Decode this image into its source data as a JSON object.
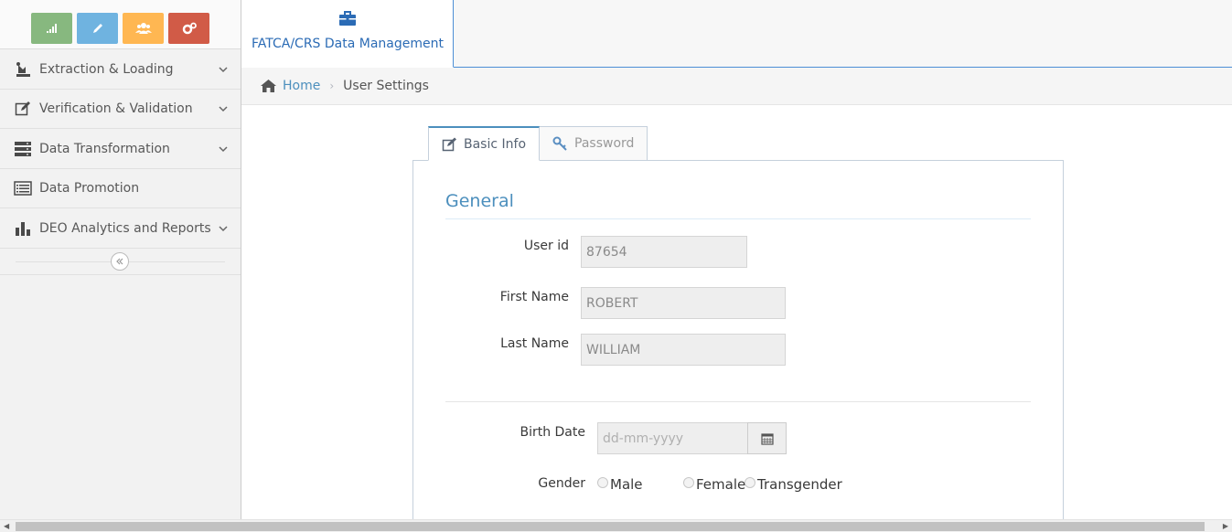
{
  "colors": {
    "shortcut_green": "#87b87f",
    "shortcut_blue": "#6fb3e0",
    "shortcut_orange": "#ffb752",
    "shortcut_red": "#d15b47",
    "accent": "#4c8fbd"
  },
  "shortcuts": [
    {
      "icon": "signal-icon"
    },
    {
      "icon": "pencil-icon"
    },
    {
      "icon": "users-icon"
    },
    {
      "icon": "cogs-icon"
    }
  ],
  "sidebar": {
    "items": [
      {
        "label": "Extraction & Loading",
        "icon": "extraction-icon",
        "expandable": true
      },
      {
        "label": "Verification & Validation",
        "icon": "edit-icon",
        "expandable": true
      },
      {
        "label": "Data Transformation",
        "icon": "server-icon",
        "expandable": true
      },
      {
        "label": "Data Promotion",
        "icon": "list-icon",
        "expandable": false
      },
      {
        "label": "DEO Analytics and Reports",
        "icon": "bar-chart-icon",
        "expandable": true
      }
    ],
    "collapse_icon": "double-left-icon"
  },
  "topbar": {
    "tab_label": "FATCA/CRS Data Management",
    "tab_icon": "briefcase-icon"
  },
  "breadcrumb": {
    "home": "Home",
    "current": "User Settings"
  },
  "tabs": [
    {
      "label": "Basic Info",
      "icon": "edit-icon",
      "active": true
    },
    {
      "label": "Password",
      "icon": "key-icon",
      "active": false
    }
  ],
  "form": {
    "section_title": "General",
    "user_id_label": "User id",
    "user_id_value": "87654",
    "first_name_label": "First Name",
    "first_name_value": "ROBERT",
    "last_name_label": "Last Name",
    "last_name_value": "WILLIAM",
    "birth_date_label": "Birth Date",
    "birth_date_placeholder": "dd-mm-yyyy",
    "gender_label": "Gender",
    "gender_options": [
      "Male",
      "Female",
      "Transgender"
    ]
  }
}
